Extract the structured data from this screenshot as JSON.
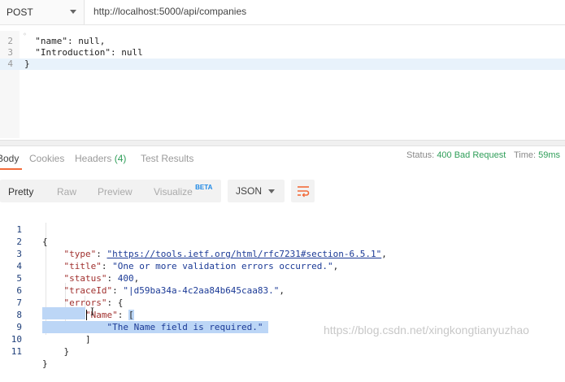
{
  "request": {
    "method": "POST",
    "url": "http://localhost:5000/api/companies"
  },
  "request_body_lines": [
    {
      "num": "2",
      "text": "  \"name\": null,"
    },
    {
      "num": "3",
      "text": "  \"Introduction\": null"
    },
    {
      "num": "4",
      "text": "}"
    }
  ],
  "response_tabs": {
    "body": "Body",
    "cookies": "Cookies",
    "headers": "Headers",
    "headers_count": "(4)",
    "test_results": "Test Results"
  },
  "status": {
    "status_label": "Status:",
    "status_value": "400 Bad Request",
    "time_label": "Time:",
    "time_value": "59ms"
  },
  "format_toolbar": {
    "pretty": "Pretty",
    "raw": "Raw",
    "preview": "Preview",
    "visualize": "Visualize",
    "beta": "BETA",
    "format": "JSON"
  },
  "response_lines": {
    "n1": "1",
    "n2": "2",
    "n3": "3",
    "n4": "4",
    "n5": "5",
    "n6": "6",
    "n7": "7",
    "n8": "8",
    "n9": "9",
    "n10": "10",
    "n11": "11",
    "open_brace": "{",
    "type_key": "\"type\"",
    "type_value": "\"https://tools.ietf.org/html/rfc7231#section-6.5.1\"",
    "title_key": "\"title\"",
    "title_value": "\"One or more validation errors occurred.\"",
    "status_key": "\"status\"",
    "status_value": "400",
    "traceid_key": "\"traceId\"",
    "traceid_value": "\"|d59ba34a-4c2aa84b645caa83.\"",
    "errors_key": "\"errors\"",
    "name_key": "\"Name\"",
    "open_bracket": "[",
    "error_msg": "\"The Name field is required.\"",
    "close_bracket": "]",
    "close_inner": "}",
    "close_brace": "}"
  },
  "watermark": "https://blog.csdn.net/xingkongtianyuzhao",
  "colors": {
    "accent": "#f26b3a",
    "status_ok_text": "#2f9e59",
    "selection": "#bcd6f6"
  }
}
